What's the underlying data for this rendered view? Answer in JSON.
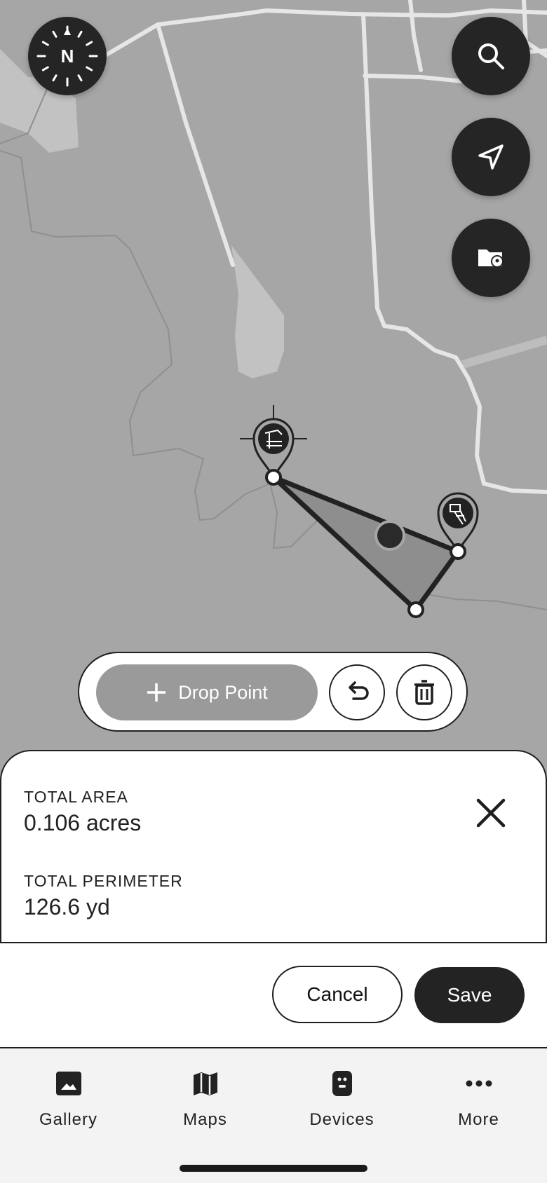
{
  "map": {
    "compass_label": "N"
  },
  "fabs": {
    "search": "search-icon",
    "locate": "navigation-arrow-icon",
    "saved_locations": "folder-pin-icon"
  },
  "toolbar": {
    "drop_point_label": "Drop Point"
  },
  "measurement": {
    "area_label": "TOTAL AREA",
    "area_value": "0.106 acres",
    "perimeter_label": "TOTAL PERIMETER",
    "perimeter_value": "126.6 yd"
  },
  "actions": {
    "cancel_label": "Cancel",
    "save_label": "Save"
  },
  "nav": {
    "items": [
      {
        "label": "Gallery",
        "icon": "image-icon"
      },
      {
        "label": "Maps",
        "icon": "map-icon"
      },
      {
        "label": "Devices",
        "icon": "camera-device-icon"
      },
      {
        "label": "More",
        "icon": "more-dots-icon"
      }
    ]
  },
  "colors": {
    "map_bg": "#a6a6a6",
    "dark": "#252525",
    "road": "#e3e3e3"
  }
}
